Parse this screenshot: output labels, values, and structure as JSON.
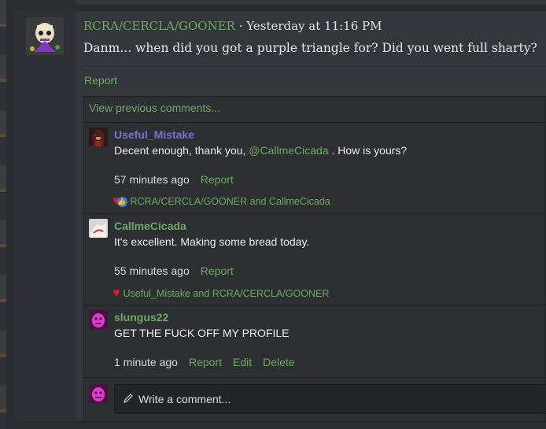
{
  "post": {
    "author": "RCRA/CERCLA/GOONER",
    "separator": " · ",
    "timestamp": "Yesterday at 11:16 PM",
    "body": "Danm... when did you got a purple triangle for? Did you went full sharty?",
    "report_label": "Report"
  },
  "comments": {
    "view_previous": "View previous comments...",
    "items": [
      {
        "username": "Useful_Mistake",
        "username_color": "#7a6fd6",
        "text_before": "Decent enough, thank you, ",
        "mention": "@CallmeCicada",
        "text_after": " . How is yours?",
        "time": "57 minutes ago",
        "report": "Report",
        "reactions": "RCRA/CERCLA/GOONER and CallmeCicada",
        "reaction_icons": [
          "heart-icon",
          "like-icon"
        ]
      },
      {
        "username": "CallmeCicada",
        "username_color": "#6bab61",
        "text": "It's excellent. Making some bread today.",
        "time": "55 minutes ago",
        "report": "Report",
        "reactions": "Useful_Mistake and RCRA/CERCLA/GOONER",
        "reaction_icons": [
          "heart-icon"
        ]
      },
      {
        "username": "slungus22",
        "username_color": "#6bab61",
        "text": "GET THE FUCK OFF MY PROFILE",
        "time": "1 minute ago",
        "report": "Report",
        "edit": "Edit",
        "delete": "Delete"
      }
    ]
  },
  "composer": {
    "placeholder": "Write a comment..."
  },
  "colors": {
    "accent_green": "#6bab61",
    "heart_red": "#d81e2a",
    "like_blue": "#2f7fd6"
  }
}
